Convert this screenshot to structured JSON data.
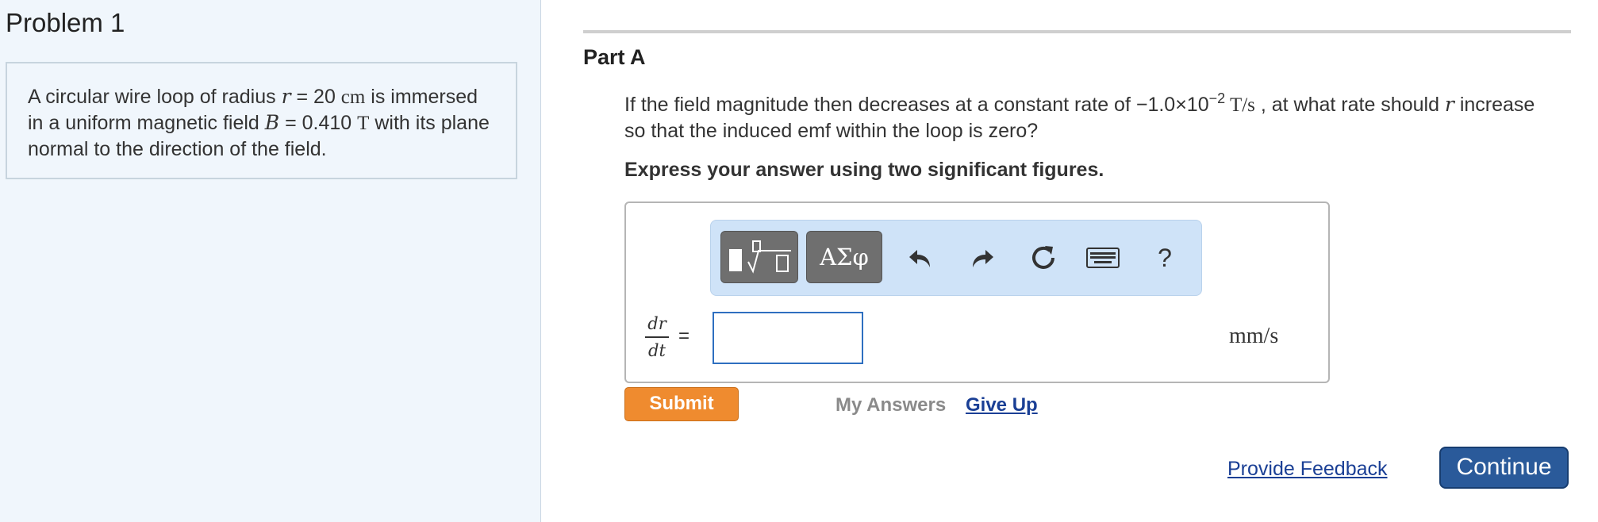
{
  "problem": {
    "title": "Problem 1",
    "text_1": "A circular wire loop of radius ",
    "var_r": "r",
    "text_2": " = 20 ",
    "unit_cm": "cm",
    "text_3": " is immersed in a uniform magnetic field ",
    "var_B": "B",
    "text_4": " = 0.410 ",
    "unit_T": "T",
    "text_5": " with its plane normal to the direction of the field."
  },
  "part": {
    "title": "Part A",
    "question_1": "If the field magnitude then decreases at a constant rate of −1.0×10",
    "exponent": "−2",
    "rate_unit": " T/s",
    "question_2": " , at what rate should ",
    "var_r": "r",
    "question_3": " increase so that the induced emf within the loop is zero?",
    "instruction": "Express your answer using two significant figures."
  },
  "toolbar": {
    "templates_icon": "templates-icon",
    "symbols_label": "ΑΣφ",
    "undo_icon": "undo-icon",
    "redo_icon": "redo-icon",
    "reset_icon": "reset-icon",
    "keyboard_icon": "keyboard-icon",
    "help_label": "?"
  },
  "answer": {
    "numerator": "dr",
    "denominator": "dt",
    "equals": "=",
    "value": "",
    "units": "mm/s"
  },
  "actions": {
    "submit_label": "Submit",
    "my_answers_label": "My Answers",
    "give_up_label": "Give Up",
    "feedback_label": "Provide Feedback",
    "continue_label": "Continue"
  },
  "colors": {
    "submit": "#ef8b2f",
    "continue": "#2a5a9a",
    "link": "#1a3f95",
    "toolbar_bg": "#cfe3f8",
    "left_pane_bg": "#f0f6fc"
  }
}
